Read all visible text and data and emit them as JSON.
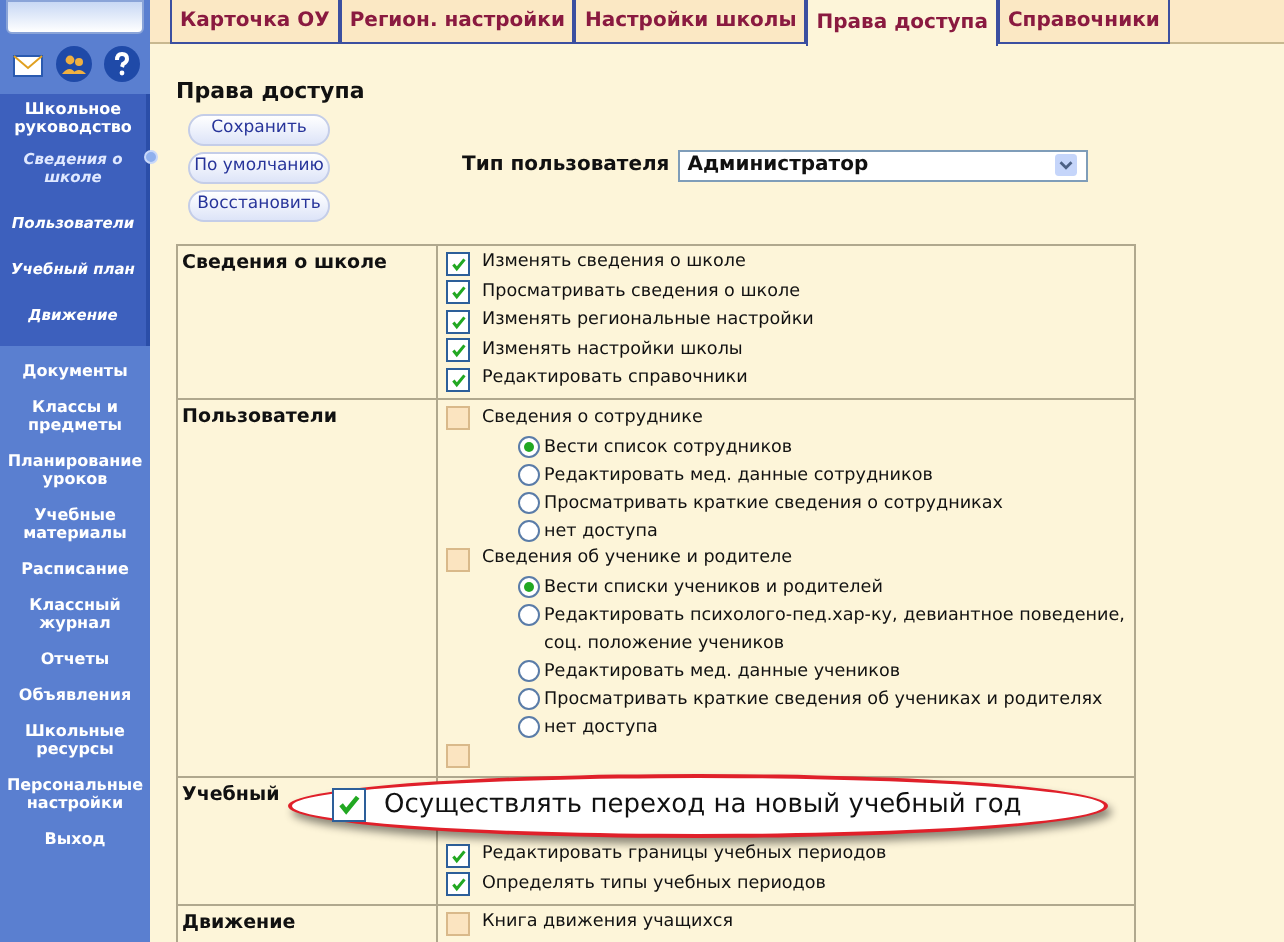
{
  "sidebar": {
    "section_title": "Школьное руководство",
    "section_items": [
      {
        "label": "Сведения о школе",
        "selected": true
      },
      {
        "label": "Пользователи",
        "selected": false
      },
      {
        "label": "Учебный план",
        "selected": false
      },
      {
        "label": "Движение",
        "selected": false
      }
    ],
    "items": [
      "Документы",
      "Классы и предметы",
      "Планирование уроков",
      "Учебные материалы",
      "Расписание",
      "Классный журнал",
      "Отчеты",
      "Объявления",
      "Школьные ресурсы",
      "Персональные настройки",
      "Выход"
    ]
  },
  "tabs": [
    {
      "label": "Карточка ОУ",
      "selected": false
    },
    {
      "label": "Регион. настройки",
      "selected": false
    },
    {
      "label": "Настройки школы",
      "selected": false
    },
    {
      "label": "Права доступа",
      "selected": true
    },
    {
      "label": "Справочники",
      "selected": false
    }
  ],
  "page_title": "Права доступа",
  "buttons": [
    "Сохранить",
    "По умолчанию",
    "Восстановить"
  ],
  "user_type": {
    "label": "Тип пользователя",
    "value": "Администратор"
  },
  "permissions": [
    {
      "group": "Сведения о школе",
      "items": [
        {
          "label": "Изменять сведения о школе",
          "checked": true
        },
        {
          "label": "Просматривать сведения о школе",
          "checked": true
        },
        {
          "label": "Изменять региональные настройки",
          "checked": true
        },
        {
          "label": "Изменять настройки школы",
          "checked": true
        },
        {
          "label": "Редактировать справочники",
          "checked": true
        }
      ]
    },
    {
      "group": "Пользователи",
      "items": [
        {
          "label": "Сведения о сотруднике",
          "checked": false,
          "options": [
            {
              "label": "Вести список сотрудников",
              "selected": true
            },
            {
              "label": "Редактировать мед. данные сотрудников",
              "selected": false
            },
            {
              "label": "Просматривать краткие сведения о сотрудниках",
              "selected": false
            },
            {
              "label": "нет доступа",
              "selected": false
            }
          ]
        },
        {
          "label": "Сведения об ученике и родителе",
          "checked": false,
          "options": [
            {
              "label": "Вести списки учеников и родителей",
              "selected": true
            },
            {
              "label": "Редактировать психолого-пед.хар-ку, девиантное поведение, соц. положение учеников",
              "selected": false
            },
            {
              "label": "Редактировать мед. данные учеников",
              "selected": false
            },
            {
              "label": "Просматривать краткие сведения об учениках и родителях",
              "selected": false
            },
            {
              "label": "нет доступа",
              "selected": false
            }
          ]
        },
        {
          "checked": false
        }
      ]
    },
    {
      "group": "Учебный",
      "callout": {
        "label": "Осуществлять переход на новый учебный год",
        "checked": true
      },
      "items": [
        {
          "label": "Редактировать границы учебных периодов",
          "checked": true
        },
        {
          "label": "Определять типы учебных периодов",
          "checked": true
        }
      ]
    },
    {
      "group": "Движение",
      "items": [
        {
          "label": "Книга движения учащихся",
          "checked": false
        }
      ]
    }
  ]
}
